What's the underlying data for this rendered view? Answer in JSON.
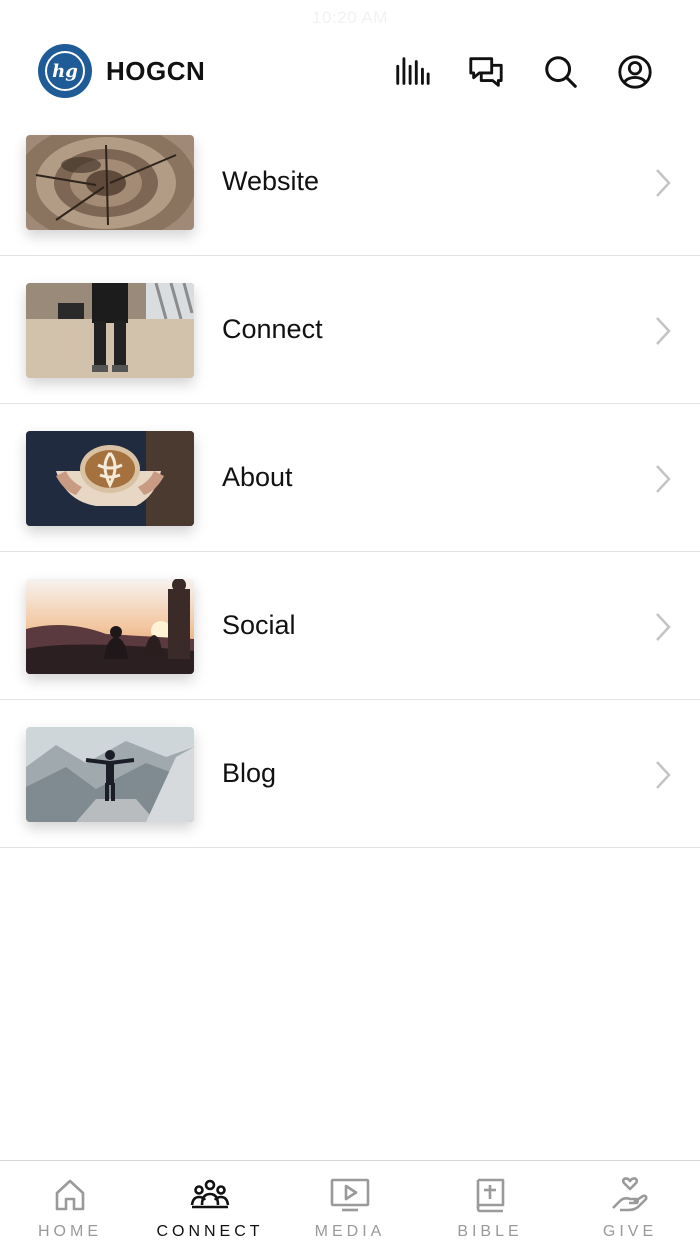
{
  "status_bar": {
    "time": "10:20 AM"
  },
  "header": {
    "logo_text": "hg",
    "title": "HOGCN",
    "icons": [
      "audio-bars-icon",
      "chat-bubbles-icon",
      "search-icon",
      "account-icon"
    ]
  },
  "list": {
    "items": [
      {
        "label": "Website",
        "thumbnail": "wood-rings-image"
      },
      {
        "label": "Connect",
        "thumbnail": "person-standing-image"
      },
      {
        "label": "About",
        "thumbnail": "latte-cup-image"
      },
      {
        "label": "Social",
        "thumbnail": "sunset-people-image"
      },
      {
        "label": "Blog",
        "thumbnail": "mountain-person-image"
      }
    ]
  },
  "tabbar": {
    "tabs": [
      {
        "label": "HOME",
        "icon": "home-icon",
        "active": false
      },
      {
        "label": "CONNECT",
        "icon": "people-group-icon",
        "active": true
      },
      {
        "label": "MEDIA",
        "icon": "play-screen-icon",
        "active": false
      },
      {
        "label": "BIBLE",
        "icon": "bible-icon",
        "active": false
      },
      {
        "label": "GIVE",
        "icon": "hand-heart-icon",
        "active": false
      }
    ]
  },
  "colors": {
    "logo_bg": "#1f5b96",
    "active_tab": "#111111",
    "inactive_tab": "#9a9a9a",
    "divider": "#e2e2e2"
  }
}
